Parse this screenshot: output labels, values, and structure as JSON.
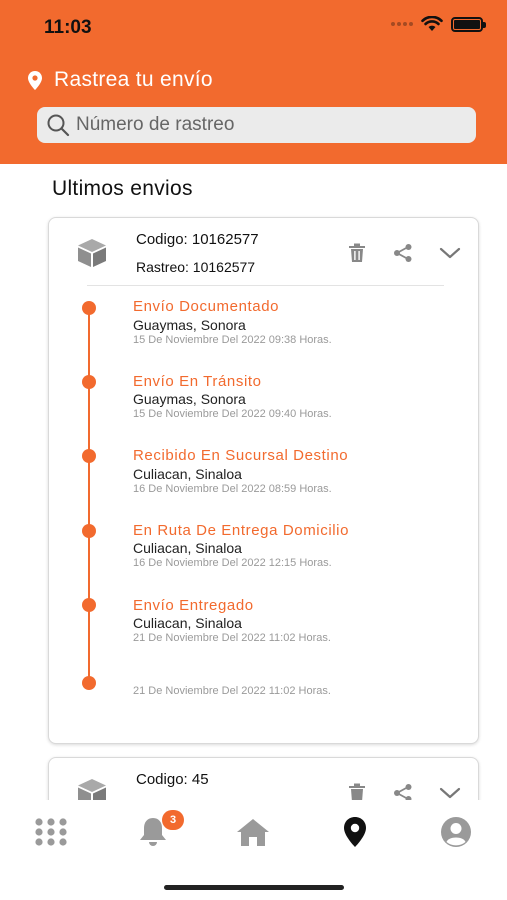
{
  "status_bar": {
    "time": "11:03"
  },
  "header": {
    "title": "Rastrea tu envío",
    "search_placeholder": "Número de rastreo"
  },
  "section_title": "Ultimos envios",
  "shipments": [
    {
      "code": "Codigo: 10162577",
      "tracking": "Rastreo: 10162577",
      "events": [
        {
          "title": "Envío Documentado",
          "place": "Guaymas, Sonora",
          "date": "15 De Noviembre Del 2022 09:38 Horas."
        },
        {
          "title": "Envío En Tránsito",
          "place": "Guaymas, Sonora",
          "date": "15 De Noviembre Del 2022 09:40 Horas."
        },
        {
          "title": "Recibido En Sucursal Destino",
          "place": "Culiacan, Sinaloa",
          "date": "16 De Noviembre Del 2022 08:59 Horas."
        },
        {
          "title": "En Ruta De Entrega Domicilio",
          "place": "Culiacan, Sinaloa",
          "date": "16 De Noviembre Del 2022 12:15 Horas."
        },
        {
          "title": "Envío Entregado",
          "place": "Culiacan, Sinaloa",
          "date": "21 De Noviembre Del 2022 11:02 Horas."
        },
        {
          "title": "",
          "place": "",
          "date": "21 De Noviembre Del 2022 11:02 Horas."
        }
      ]
    },
    {
      "code": "Codigo: 45"
    }
  ],
  "tab_bar": {
    "items": [
      {
        "icon": "grid-icon"
      },
      {
        "icon": "bell-icon",
        "badge": "3"
      },
      {
        "icon": "home-icon"
      },
      {
        "icon": "map-pin-icon",
        "active": true
      },
      {
        "icon": "profile-icon"
      }
    ]
  },
  "colors": {
    "accent": "#f26a2e",
    "active_tab": "#111111",
    "inactive_tab": "#9a9a9a"
  }
}
